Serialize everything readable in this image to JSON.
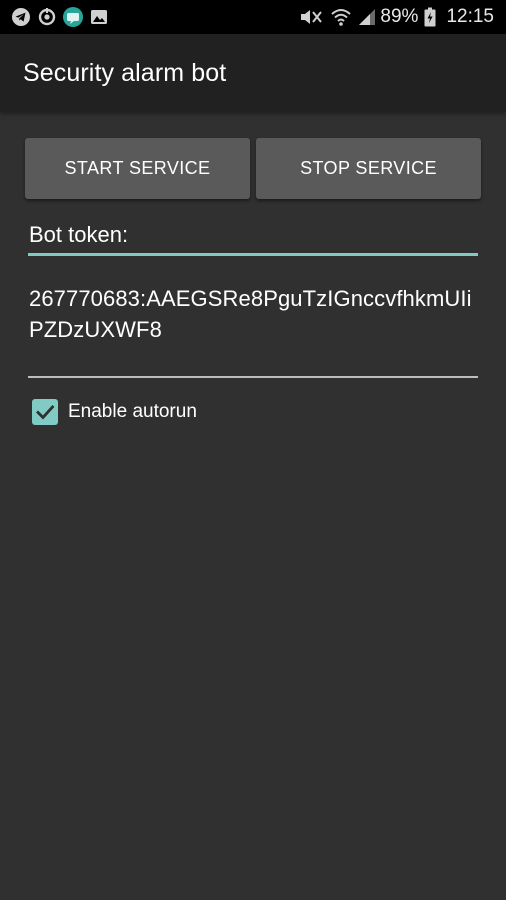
{
  "status_bar": {
    "left_icons": [
      "telegram-icon",
      "sync-icon",
      "chat-bubble-icon",
      "image-icon"
    ],
    "right_icons": [
      "mute-icon",
      "wifi-icon",
      "signal-icon",
      "battery-charging-icon"
    ],
    "battery": "89%",
    "time": "12:15"
  },
  "app_bar": {
    "title": "Security alarm bot"
  },
  "buttons": {
    "start_label": "START SERVICE",
    "stop_label": "STOP SERVICE"
  },
  "token": {
    "label": "Bot token:",
    "value": "267770683:AAEGSRe8PguTzIGnccvfhkmUIiPZDzUXWF8"
  },
  "autorun": {
    "label": "Enable autorun",
    "checked": true
  },
  "colors": {
    "accent": "#80cbc4",
    "background": "#303030",
    "app_bar": "#212121",
    "button": "#5a5a5a"
  }
}
